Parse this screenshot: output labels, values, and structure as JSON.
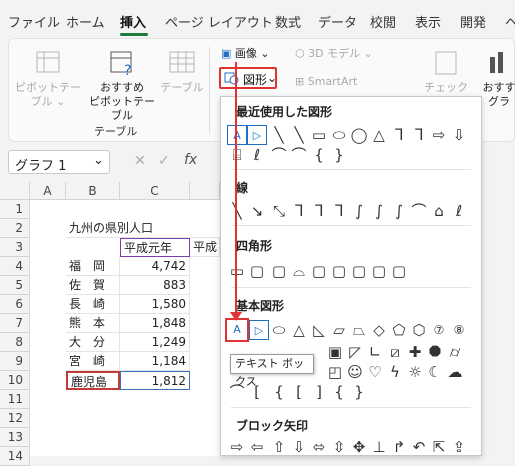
{
  "tabs": [
    "ファイル",
    "ホーム",
    "挿入",
    "ページ レイアウト",
    "数式",
    "データ",
    "校閲",
    "表示",
    "開発",
    "ヘ"
  ],
  "ribbon": {
    "pivot": "ピボットテー\nブル",
    "pivot_line1": "ピボットテー",
    "pivot_line2": "ブル ⌄",
    "recommended_line1": "おすすめ",
    "recommended_line2": "ピボットテーブル",
    "table": "テーブル",
    "group_label": "テーブル",
    "image": "画像",
    "model3d": "3D モデル",
    "shapes": "図形",
    "smartart": "SmartArt",
    "check": "チェック",
    "recommended_chart_line1": "おすす",
    "recommended_chart_line2": "グラ"
  },
  "namebox": {
    "value": "グラフ 1"
  },
  "grid": {
    "columns": [
      "A",
      "B",
      "C"
    ],
    "rows": [
      "1",
      "2",
      "3",
      "4",
      "5",
      "6",
      "7",
      "8",
      "9",
      "10",
      "11",
      "12",
      "13",
      "14"
    ],
    "title": "九州の県別人口",
    "header_c": "平成元年",
    "header_d": "平成",
    "data": [
      {
        "pref": "福　岡",
        "value": "4,742"
      },
      {
        "pref": "佐　賀",
        "value": "883"
      },
      {
        "pref": "長　崎",
        "value": "1,580"
      },
      {
        "pref": "熊　本",
        "value": "1,848"
      },
      {
        "pref": "大　分",
        "value": "1,249"
      },
      {
        "pref": "宮　崎",
        "value": "1,184"
      },
      {
        "pref": "鹿児島",
        "value": "1,812"
      }
    ]
  },
  "panel": {
    "recent": "最近使用した図形",
    "lines": "線",
    "rect": "四角形",
    "basic": "基本図形",
    "block_arrows": "ブロック矢印"
  },
  "tooltip": "テキスト ボックス",
  "colors": {
    "accent_red": "#e23333",
    "tab_underline": "#1b7d3a",
    "selection_purple": "#7b3fb3"
  }
}
